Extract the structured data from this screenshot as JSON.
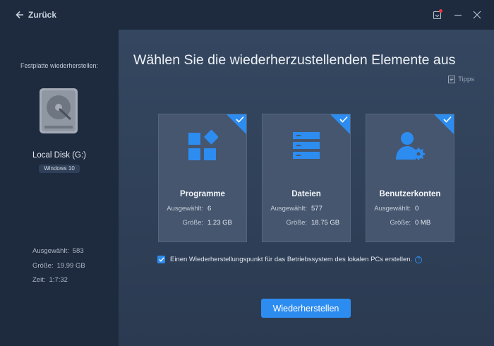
{
  "titlebar": {
    "back_label": "Zurück",
    "icons": [
      "arrow-left-icon",
      "download-notify-icon",
      "minimize-icon",
      "close-icon"
    ],
    "notify_color": "#e23b3b"
  },
  "sidebar": {
    "heading": "Festplatte wiederherstellen:",
    "disk_name": "Local Disk (G:)",
    "os_badge": "Windows 10",
    "stats": [
      {
        "label": "Ausgewählt:",
        "value": "583"
      },
      {
        "label": "Größe:",
        "value": "19.99 GB"
      },
      {
        "label": "Zeit:",
        "value": "1:7:32"
      }
    ]
  },
  "main": {
    "title": "Wählen Sie die wiederherzustellenden Elemente aus",
    "tips_label": "Tipps",
    "accent_color": "#2d8cf0",
    "cards": [
      {
        "title": "Programme",
        "icon": "apps-icon",
        "selected": true,
        "selected_label": "Ausgewählt:",
        "selected_value": "6",
        "size_label": "Größe:",
        "size_value": "1.23 GB"
      },
      {
        "title": "Dateien",
        "icon": "files-icon",
        "selected": true,
        "selected_label": "Ausgewählt:",
        "selected_value": "577",
        "size_label": "Größe:",
        "size_value": "18.75 GB"
      },
      {
        "title": "Benutzerkonten",
        "icon": "user-settings-icon",
        "selected": true,
        "selected_label": "Ausgewählt:",
        "selected_value": "0",
        "size_label": "Größe:",
        "size_value": "0 MB"
      }
    ],
    "restore_point": {
      "checked": true,
      "label": "Einen Wiederherstellungspunkt für das Betriebssystem des lokalen PCs erstellen.",
      "help_symbol": "?"
    },
    "primary_button": "Wiederherstellen"
  }
}
